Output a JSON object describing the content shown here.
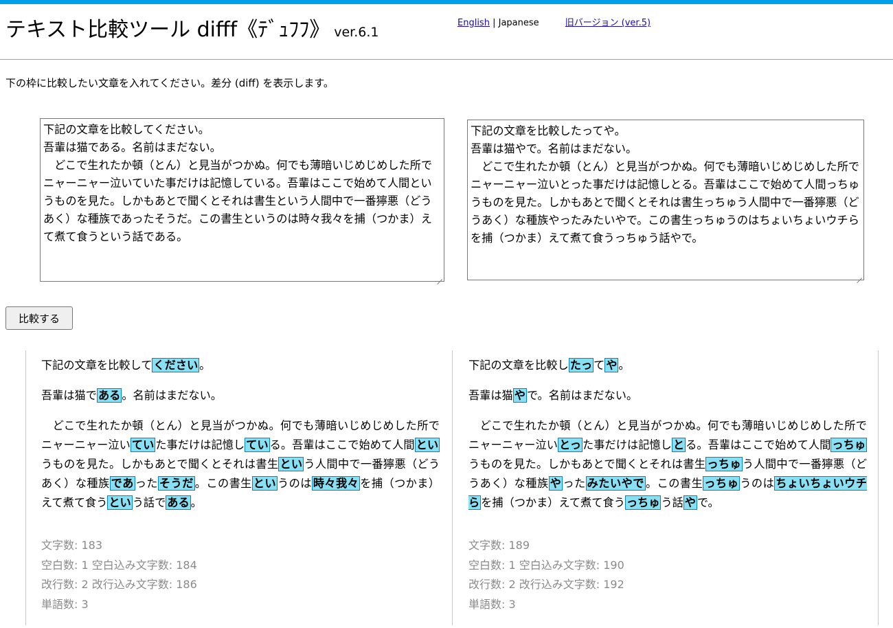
{
  "header": {
    "title": "テキスト比較ツール difff《ﾃﾞｭﾌﾌ》",
    "version": "ver.6.1",
    "lang_english": "English",
    "lang_separator": "|",
    "lang_japanese": "Japanese",
    "old_version": "旧バージョン (ver.5)",
    "accent_color": "#00a0ea"
  },
  "intro": "下の枠に比較したい文章を入れてください。差分 (diff) を表示します。",
  "input": {
    "left": "下記の文章を比較してください。\n吾輩は猫である。名前はまだない。\n　どこで生れたか頓（とん）と見当がつかぬ。何でも薄暗いじめじめした所でニャーニャー泣いていた事だけは記憶している。吾輩はここで始めて人間というものを見た。しかもあとで聞くとそれは書生という人間中で一番獰悪（どうあく）な種族であったそうだ。この書生というのは時々我々を捕（つかま）えて煮て食うという話である。",
    "right": "下記の文章を比較したってや。\n吾輩は猫やで。名前はまだない。\n　どこで生れたか頓（とん）と見当がつかぬ。何でも薄暗いじめじめした所でニャーニャー泣いとった事だけは記憶しとる。吾輩はここで始めて人間っちゅうものを見た。しかもあとで聞くとそれは書生っちゅう人間中で一番獰悪（どうあく）な種族やったみたいやで。この書生っちゅうのはちょいちょいウチらを捕（つかま）えて煮て食うっちゅう話やで。"
  },
  "compare_button": "比較する",
  "result": {
    "highlight_color": "#87e0f3",
    "left": {
      "line1": [
        "下記の文章を比較して",
        "ください",
        "。"
      ],
      "line2": [
        "吾輩は猫で",
        "ある",
        "。名前はまだない。"
      ],
      "body": [
        "　どこで生れたか頓（とん）と見当がつかぬ。何でも薄暗いじめじめした所でニャーニャー泣い",
        "てい",
        "た事だけは記憶し",
        "てい",
        "る。吾輩はここで始めて人間",
        "とい",
        "うものを見た。しかもあとで聞くとそれは書生",
        "とい",
        "う人間中で一番獰悪（どうあく）な種族",
        "であ",
        "った",
        "そうだ",
        "。この書生",
        "とい",
        "うのは",
        "時々我々",
        "を捕（つかま）えて煮て食う",
        "とい",
        "う話で",
        "ある",
        "。"
      ],
      "stats": {
        "chars": "文字数: 183",
        "spaces": "空白数: 1 空白込み文字数: 184",
        "newlines": "改行数: 2 改行込み文字数: 186",
        "words": "単語数: 3"
      }
    },
    "right": {
      "line1": [
        "下記の文章を比較し",
        "たっ",
        "て",
        "や",
        "。"
      ],
      "line2": [
        "吾輩は猫",
        "や",
        "で。名前はまだない。"
      ],
      "body": [
        "　どこで生れたか頓（とん）と見当がつかぬ。何でも薄暗いじめじめした所でニャーニャー泣い",
        "とっ",
        "た事だけは記憶し",
        "と",
        "る。吾輩はここで始めて人間",
        "っちゅ",
        "うものを見た。しかもあとで聞くとそれは書生",
        "っちゅ",
        "う人間中で一番獰悪（どうあく）な種族",
        "や",
        "った",
        "みたいやで",
        "。この書生",
        "っちゅ",
        "うのは",
        "ちょいちょいウチら",
        "を捕（つかま）えて煮て食う",
        "っちゅ",
        "う話",
        "や",
        "で。"
      ],
      "stats": {
        "chars": "文字数: 189",
        "spaces": "空白数: 1 空白込み文字数: 190",
        "newlines": "改行数: 2 改行込み文字数: 192",
        "words": "単語数: 3"
      }
    }
  }
}
